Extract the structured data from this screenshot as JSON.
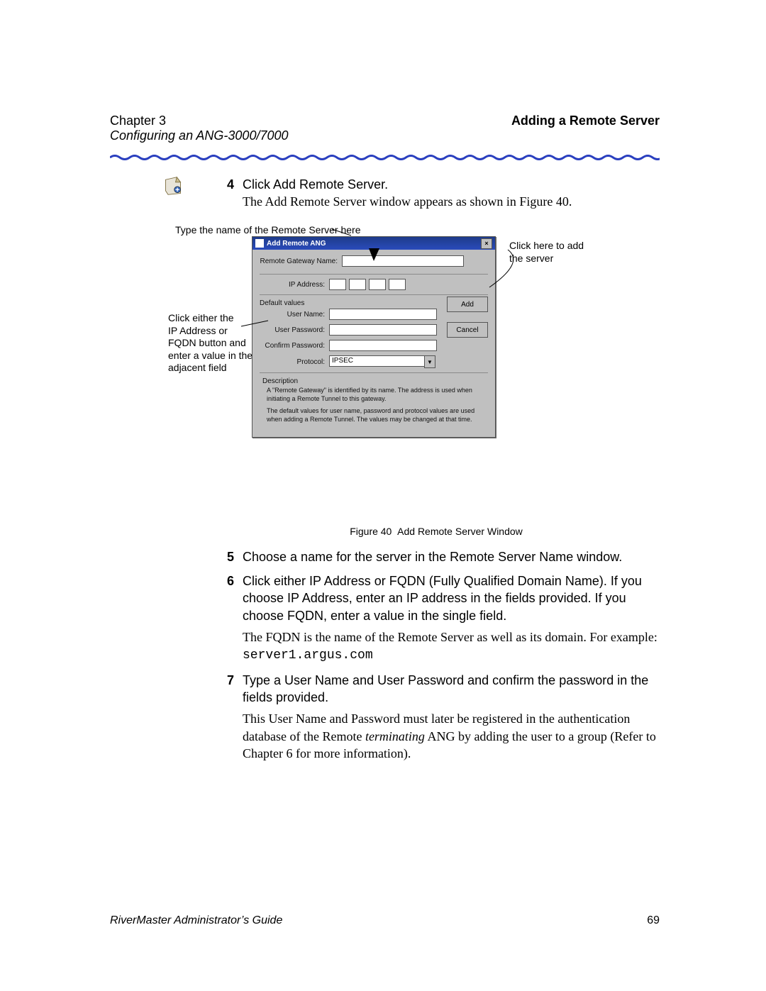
{
  "header": {
    "chapter": "Chapter 3",
    "section": "Adding a Remote Server",
    "subtitle": "Configuring an ANG-3000/7000"
  },
  "callouts": {
    "top": "Type the name of the Remote Server here",
    "right1": "Click here to add",
    "right2": "the server",
    "left1": "Click either the",
    "left2": "IP Address or",
    "left3": "FQDN button and",
    "left4": "enter a value in the",
    "left5": "adjacent field"
  },
  "dialog": {
    "title": "Add Remote ANG",
    "labels": {
      "gateway_name": "Remote Gateway Name:",
      "ip": "IP Address:",
      "defaults": "Default values",
      "user_name": "User Name:",
      "user_pass": "User Password:",
      "confirm": "Confirm Password:",
      "protocol": "Protocol:",
      "description": "Description"
    },
    "protocol_value": "IPSEC",
    "desc1": "A \"Remote Gateway\" is identified by its name.  The address is used when initiating a Remote Tunnel to this gateway.",
    "desc2": "The default values for user name, password and protocol values are used when adding a Remote Tunnel.  The values may be changed at that time.",
    "buttons": {
      "add": "Add",
      "cancel": "Cancel"
    }
  },
  "figure": {
    "label": "Figure 40",
    "text": "Add Remote Server Window"
  },
  "steps": {
    "s4a": "Click Add Remote Server.",
    "s4b": "The Add Remote Server window appears as shown in Figure 40.",
    "s5": "Choose a name for the server in the Remote Server Name window.",
    "s6a": "Click either IP Address or FQDN (Fully Qualified Domain Name). If you choose IP Address, enter an IP address in the fields provided. If you choose FQDN, enter a value in the single field.",
    "s6b": "The FQDN is the name of the Remote Server as well as its domain. For example: ",
    "s6_code": "server1.argus.com",
    "s7a": "Type a User Name and User Password and confirm the password in the fields provided.",
    "s7b_1": "This User Name and Password must later be registered in the authentication database of the Remote ",
    "s7b_em": "terminating",
    "s7b_2": " ANG by adding the user to a group (Refer to Chapter 6 for more information)."
  },
  "footer": {
    "guide": "RiverMaster Administrator’s Guide",
    "page": "69"
  }
}
